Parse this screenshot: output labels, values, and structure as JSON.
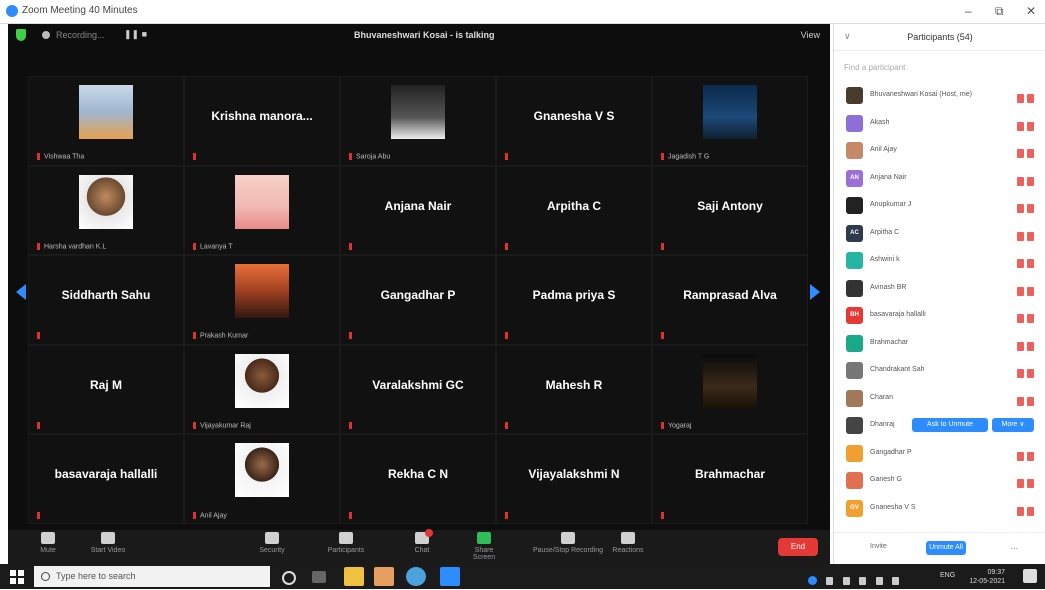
{
  "window": {
    "title": "Zoom Meeting 40 Minutes",
    "controls": [
      "–",
      "⧉",
      "✕"
    ]
  },
  "meeting": {
    "recording_text": "Recording...",
    "speaking_label": "Bhuvaneshwari  Kosai - is talking",
    "view_label": "View"
  },
  "tiles": [
    {
      "name": "",
      "label": "Vishwaa Tha",
      "photo": "man-standing"
    },
    {
      "name": "Krishna  manora...",
      "label": "",
      "photo": ""
    },
    {
      "name": "",
      "label": "Saroja Abu",
      "photo": "person-sketch"
    },
    {
      "name": "Gnanesha V S",
      "label": "",
      "photo": ""
    },
    {
      "name": "",
      "label": "Jagadish T G",
      "photo": "stage-banner"
    },
    {
      "name": "",
      "label": "Harsha vardhan K.L",
      "photo": "man-portrait"
    },
    {
      "name": "",
      "label": "Lavanya T",
      "photo": "girl-cartoon"
    },
    {
      "name": "Anjana Nair",
      "label": "",
      "photo": ""
    },
    {
      "name": "Arpitha C",
      "label": "",
      "photo": ""
    },
    {
      "name": "Saji Antony",
      "label": "",
      "photo": ""
    },
    {
      "name": "Siddharth Sahu",
      "label": "",
      "photo": ""
    },
    {
      "name": "",
      "label": "Prakash Kumar",
      "photo": "man-group"
    },
    {
      "name": "Gangadhar P",
      "label": "",
      "photo": ""
    },
    {
      "name": "Padma priya S",
      "label": "",
      "photo": ""
    },
    {
      "name": "Ramprasad Alva",
      "label": "",
      "photo": ""
    },
    {
      "name": "Raj M",
      "label": "",
      "photo": ""
    },
    {
      "name": "",
      "label": "Vijayakumar Raj",
      "photo": "man-mustache"
    },
    {
      "name": "Varalakshmi GC",
      "label": "",
      "photo": ""
    },
    {
      "name": "Mahesh R",
      "label": "",
      "photo": ""
    },
    {
      "name": "",
      "label": "Yogaraj",
      "photo": "dark-scene"
    },
    {
      "name": "basavaraja hallalli",
      "label": "",
      "photo": ""
    },
    {
      "name": "",
      "label": "Anil Ajay",
      "photo": "man-elder"
    },
    {
      "name": "Rekha C N",
      "label": "",
      "photo": ""
    },
    {
      "name": "Vijayalakshmi N",
      "label": "",
      "photo": ""
    },
    {
      "name": "Brahmachar",
      "label": "",
      "photo": ""
    }
  ],
  "toolbar": {
    "items": [
      {
        "label": "Mute",
        "color": "#d0d0d0"
      },
      {
        "label": "Start Video",
        "color": "#d0d0d0"
      },
      {
        "label": "Security",
        "color": "#d0d0d0"
      },
      {
        "label": "Participants",
        "color": "#d0d0d0"
      },
      {
        "label": "Chat",
        "color": "#d0d0d0"
      },
      {
        "label": "Share Screen",
        "color": "#2ebd59"
      },
      {
        "label": "Pause/Stop Recording",
        "color": "#d0d0d0"
      },
      {
        "label": "Reactions",
        "color": "#d0d0d0"
      }
    ],
    "end_label": "End"
  },
  "participants_panel": {
    "title": "Participants (54)",
    "search_placeholder": "Find a participant",
    "rows": [
      {
        "initials": "",
        "name": "Bhuvaneshwari Kosai (Host, me)",
        "color": "#4a3b2f"
      },
      {
        "initials": "",
        "name": "Akash",
        "color": "#8e6fd8"
      },
      {
        "initials": "",
        "name": "Anil Ajay",
        "color": "#c48a6a"
      },
      {
        "initials": "AN",
        "name": "Anjana Nair",
        "color": "#9a6fd8"
      },
      {
        "initials": "",
        "name": "Anupkumar J",
        "color": "#222"
      },
      {
        "initials": "AC",
        "name": "Arpitha C",
        "color": "#2f3b4a"
      },
      {
        "initials": "",
        "name": "Ashwini k",
        "color": "#26b5a0"
      },
      {
        "initials": "",
        "name": "Avinash BR",
        "color": "#333"
      },
      {
        "initials": "BH",
        "name": "basavaraja hallalli",
        "color": "#e53935"
      },
      {
        "initials": "",
        "name": "Brahmachar",
        "color": "#1aa98a"
      },
      {
        "initials": "",
        "name": "Chandrakant Sah",
        "color": "#777"
      },
      {
        "initials": "",
        "name": "Charan",
        "color": "#a0785a"
      },
      {
        "initials": "",
        "name": "Dhanraj",
        "color": "#444"
      },
      {
        "initials": "",
        "name": "Gangadhar P",
        "color": "#f0a030"
      },
      {
        "initials": "",
        "name": "Ganesh G",
        "color": "#e07050"
      },
      {
        "initials": "GV",
        "name": "Gnanesha V S",
        "color": "#f0a030"
      }
    ],
    "ask_unmute_label": "Ask to Unmute",
    "more_label": "More ∨",
    "invite_label": "Invite",
    "unmute_all_label": "Unmute All",
    "ellipsis": "..."
  },
  "taskbar": {
    "search_placeholder": "Type here to search",
    "time": "09:37",
    "date": "12-05-2021",
    "lang": "ENG"
  }
}
